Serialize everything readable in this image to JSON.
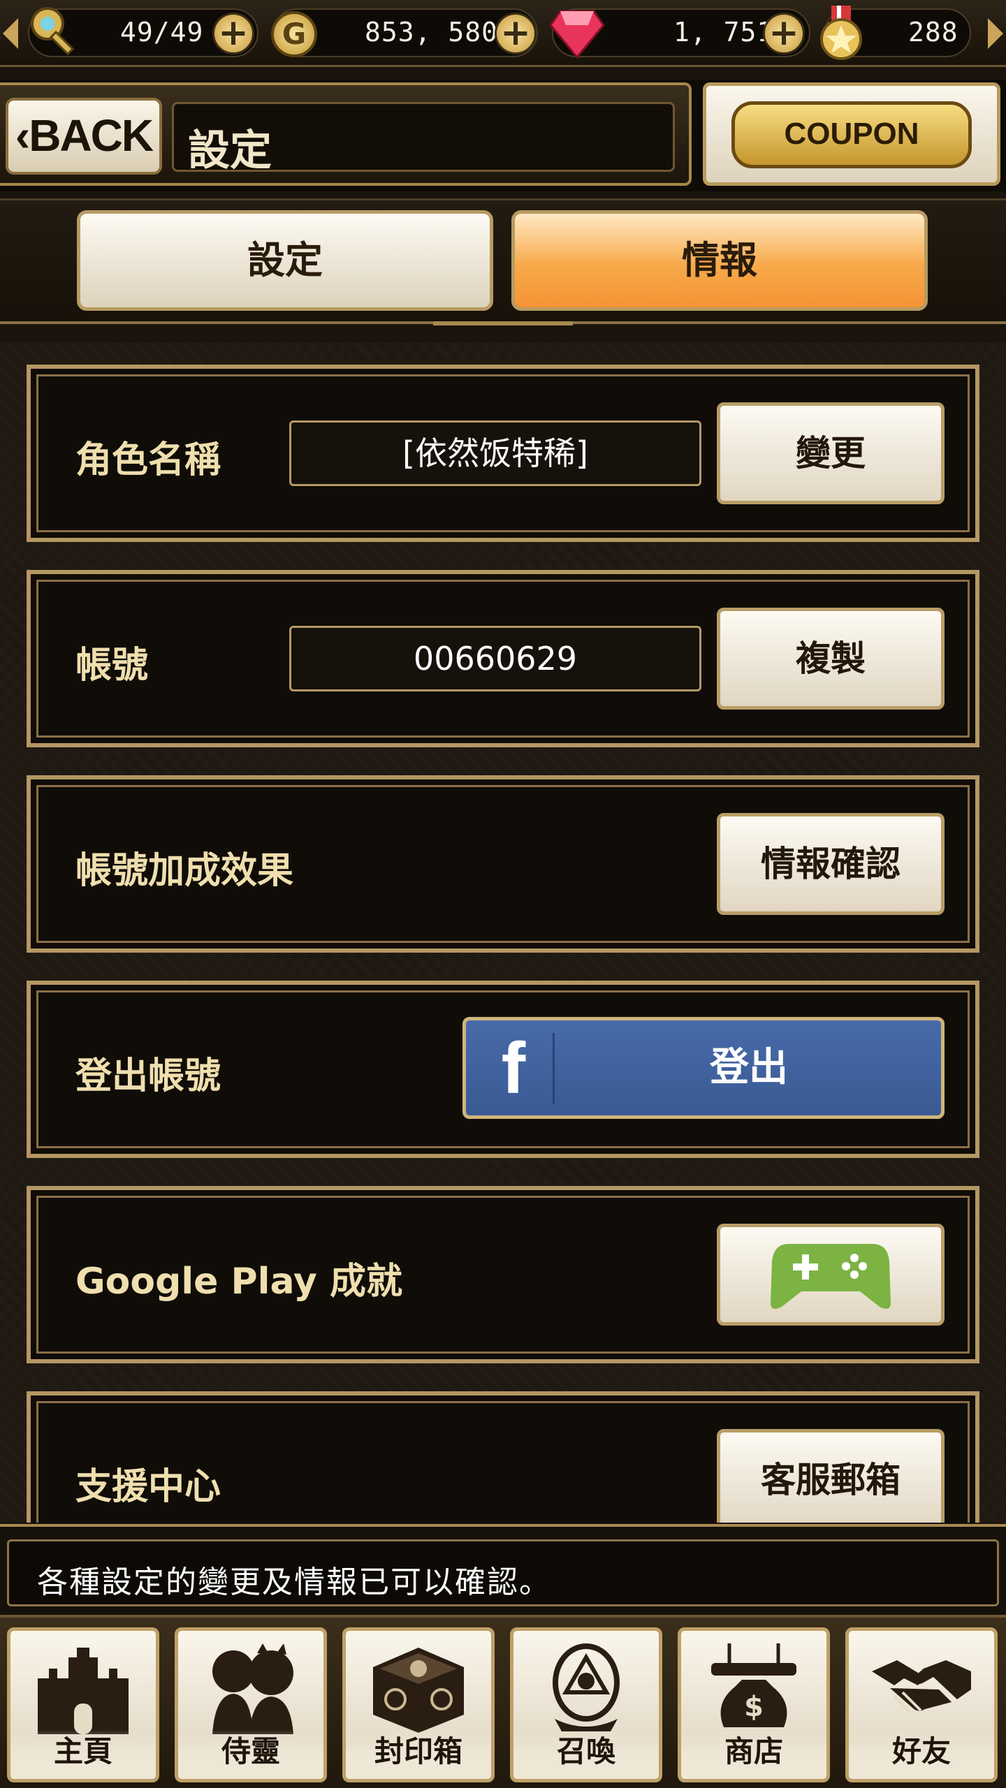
{
  "resources": {
    "stamina": "49/49",
    "gold": "853, 580",
    "gems": "1, 751",
    "medals": "288",
    "gold_icon_letter": "G",
    "icons": [
      "key-icon",
      "gold-coin-icon",
      "ruby-gem-icon",
      "star-medal-icon"
    ]
  },
  "header": {
    "back_label": "BACK",
    "title": "設定",
    "coupon_label": "COUPON"
  },
  "tabs": [
    {
      "label": "設定",
      "active": false
    },
    {
      "label": "情報",
      "active": true
    }
  ],
  "rows": {
    "character_name": {
      "label": "角色名稱",
      "value": "[依然饭特稀]",
      "button": "變更"
    },
    "account": {
      "label": "帳號",
      "value": "00660629",
      "button": "複製"
    },
    "account_bonus": {
      "label": "帳號加成效果",
      "button": "情報確認"
    },
    "logout": {
      "label": "登出帳號",
      "button": "登出",
      "provider_icon": "facebook-icon"
    },
    "google_play": {
      "label": "Google Play 成就",
      "button_icon": "gamepad-icon"
    },
    "support": {
      "label": "支援中心",
      "button": "客服郵箱"
    }
  },
  "tip": "各種設定的變更及情報已可以確認。",
  "nav": [
    {
      "label": "主頁",
      "icon": "castle-icon"
    },
    {
      "label": "侍靈",
      "icon": "spirits-icon"
    },
    {
      "label": "封印箱",
      "icon": "seal-box-icon"
    },
    {
      "label": "召喚",
      "icon": "summon-icon"
    },
    {
      "label": "商店",
      "icon": "shop-icon"
    },
    {
      "label": "好友",
      "icon": "friends-icon"
    }
  ],
  "colors": {
    "accent_gold": "#b59763",
    "active_tab": "#f7a94a",
    "facebook_blue": "#3b5998",
    "gamepad_green": "#7cb342"
  }
}
